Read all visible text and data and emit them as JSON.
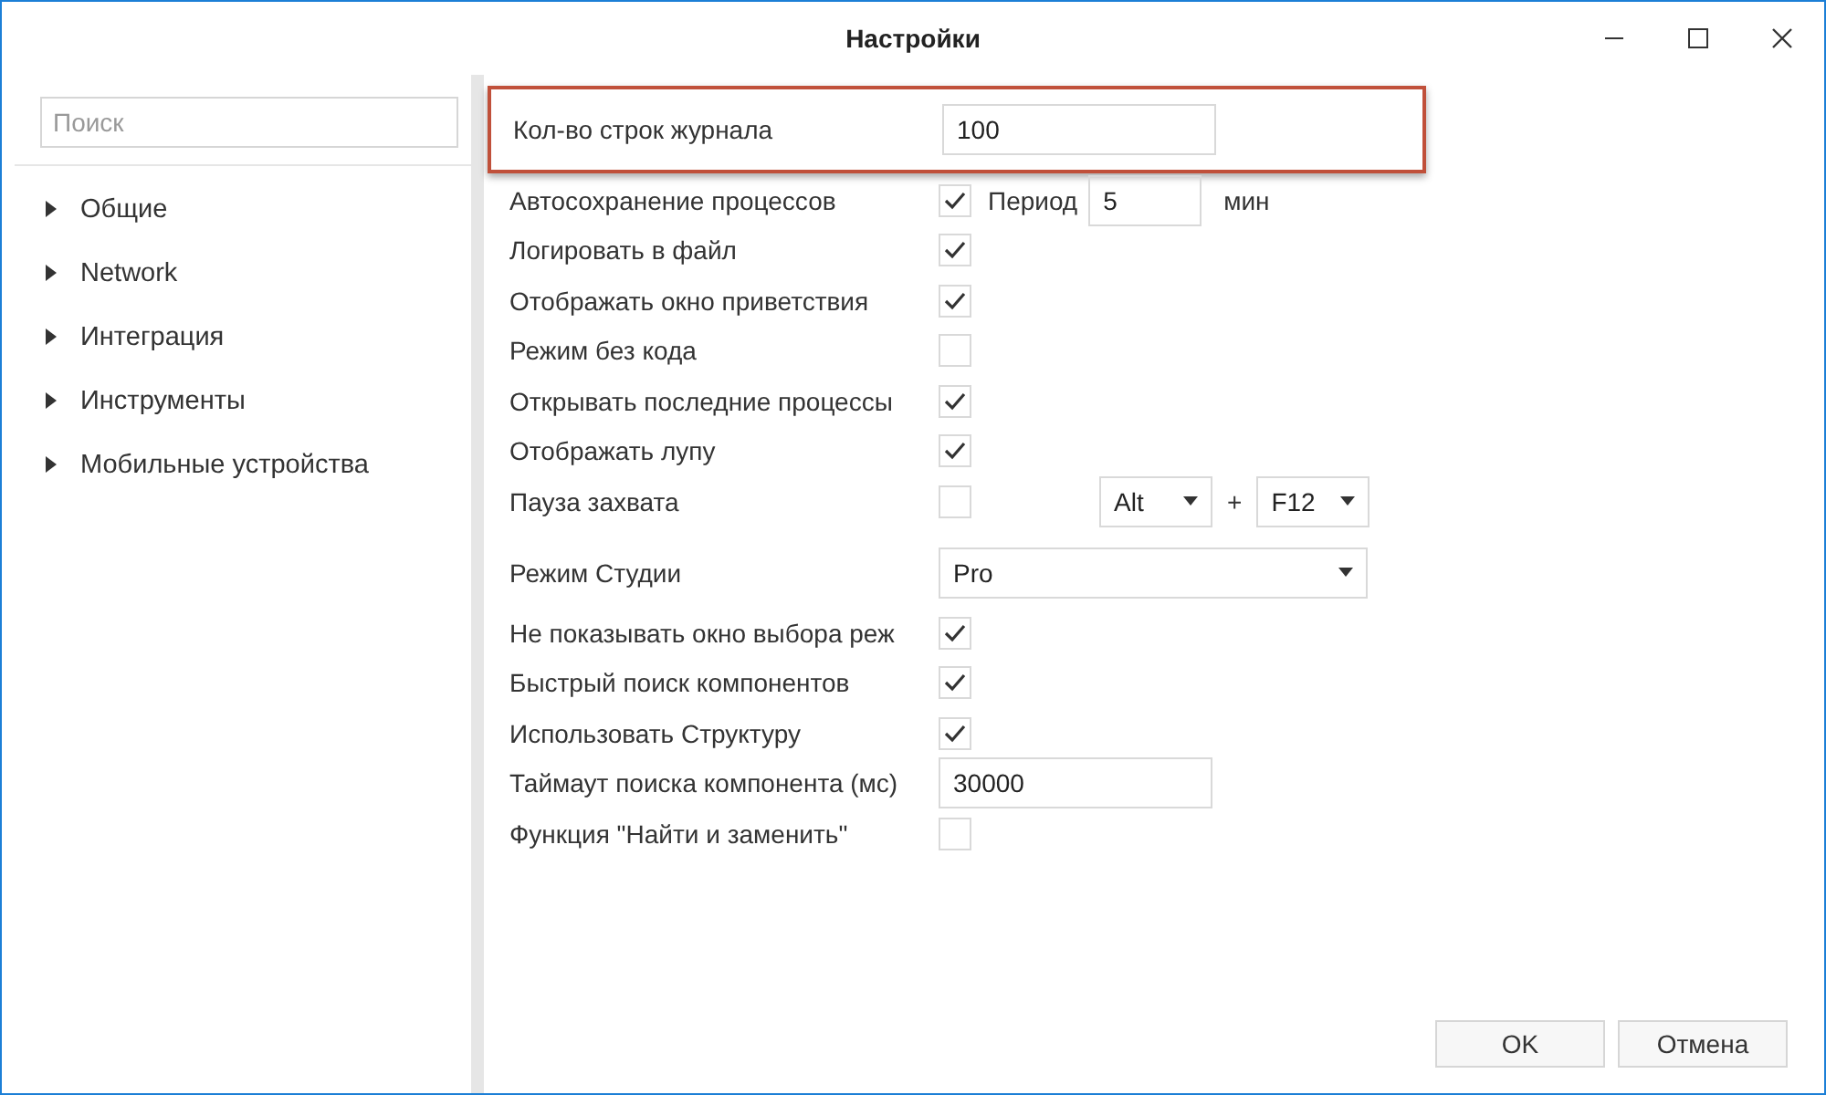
{
  "window": {
    "title": "Настройки"
  },
  "sidebar": {
    "search": {
      "placeholder": "Поиск"
    },
    "items": [
      {
        "label": "Общие",
        "expanded": false
      },
      {
        "label": "Network",
        "expanded": false
      },
      {
        "label": "Интеграция",
        "expanded": false
      },
      {
        "label": "Инструменты",
        "expanded": false
      },
      {
        "label": "Мобильные устройства",
        "expanded": false
      }
    ]
  },
  "settings": [
    {
      "kind": "text",
      "label": "Кол-во строк журнала",
      "value": "100",
      "highlighted": true
    },
    {
      "kind": "period",
      "label": "Автосохранение процессов",
      "checked": true,
      "period_label": "Период",
      "period_value": "5",
      "unit": "мин"
    },
    {
      "kind": "checkbox",
      "label": "Логировать в файл",
      "checked": true
    },
    {
      "kind": "checkbox",
      "label": "Отображать окно приветствия",
      "checked": true
    },
    {
      "kind": "checkbox",
      "label": "Режим без кода",
      "checked": false
    },
    {
      "kind": "checkbox",
      "label": "Открывать последние процессы",
      "checked": true
    },
    {
      "kind": "checkbox",
      "label": "Отображать лупу",
      "checked": true
    },
    {
      "kind": "hotkey",
      "label": "Пауза захвата",
      "checked": false,
      "modifier": "Alt",
      "plus": "+",
      "key": "F12"
    },
    {
      "kind": "select",
      "label": "Режим Студии",
      "value": "Pro"
    },
    {
      "kind": "checkbox",
      "label": "Не показывать окно выбора реж",
      "checked": true
    },
    {
      "kind": "checkbox",
      "label": "Быстрый поиск компонентов",
      "checked": true
    },
    {
      "kind": "checkbox",
      "label": "Использовать Структуру",
      "checked": true
    },
    {
      "kind": "text",
      "label": "Таймаут поиска компонента (мс)",
      "value": "30000"
    },
    {
      "kind": "checkbox",
      "label": "Функция \"Найти и заменить\"",
      "checked": false
    }
  ],
  "buttons": [
    "OK",
    "Отмена"
  ]
}
